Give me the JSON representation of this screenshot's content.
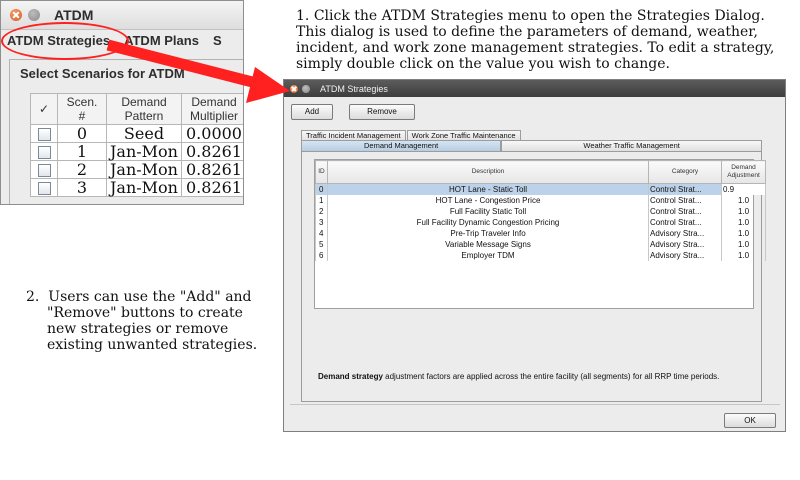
{
  "annotations": {
    "step1_number": "1.",
    "step1_text": "Click the ATDM Strategies menu to open the Strategies Dialog. This dialog is used to define the parameters of demand, weather, incident, and work zone management strategies.  To edit a strategy, simply double click on the value you wish to change.",
    "step2_number": "2.",
    "step2_text": "Users can use the \"Add\" and \"Remove\" buttons to create new strategies or remove existing unwanted strategies."
  },
  "main_window": {
    "title": "ATDM",
    "menu": [
      "ATDM Strategies",
      "ATDM Plans",
      "S"
    ],
    "panel_title": "Select Scenarios for ATDM",
    "table": {
      "headers": [
        "✓",
        "Scen.\n#",
        "Demand\nPattern",
        "Demand\nMultiplier"
      ],
      "rows": [
        {
          "scen": "0",
          "pattern": "Seed",
          "multiplier": "0.0000"
        },
        {
          "scen": "1",
          "pattern": "Jan-Mon",
          "multiplier": "0.8261"
        },
        {
          "scen": "2",
          "pattern": "Jan-Mon",
          "multiplier": "0.8261"
        },
        {
          "scen": "3",
          "pattern": "Jan-Mon",
          "multiplier": "0.8261"
        }
      ]
    }
  },
  "dialog": {
    "title": "ATDM Strategies",
    "add_label": "Add",
    "remove_label": "Remove",
    "tabs_row1": [
      "Traffic Incident Management",
      "Work Zone Traffic Maintenance"
    ],
    "tabs_row2": [
      "Demand Management",
      "Weather Traffic Management"
    ],
    "active_tab": "Demand Management",
    "table": {
      "headers": {
        "id": "ID",
        "description": "Description",
        "category": "Category",
        "adjustment": "Demand\nAdjustment"
      },
      "rows": [
        {
          "id": "0",
          "description": "HOT Lane - Static Toll",
          "category": "Control Strat...",
          "adjustment": "0.9",
          "selected": true
        },
        {
          "id": "1",
          "description": "HOT Lane - Congestion Price",
          "category": "Control Strat...",
          "adjustment": "1.0"
        },
        {
          "id": "2",
          "description": "Full Facility Static Toll",
          "category": "Control Strat...",
          "adjustment": "1.0"
        },
        {
          "id": "3",
          "description": "Full Facility Dynamic Congestion Pricing",
          "category": "Control Strat...",
          "adjustment": "1.0"
        },
        {
          "id": "4",
          "description": "Pre-Trip Traveler Info",
          "category": "Advisory Stra...",
          "adjustment": "1.0"
        },
        {
          "id": "5",
          "description": "Variable Message Signs",
          "category": "Advisory Stra...",
          "adjustment": "1.0"
        },
        {
          "id": "6",
          "description": "Employer TDM",
          "category": "Advisory Stra...",
          "adjustment": "1.0"
        }
      ]
    },
    "description_bold": "Demand strategy",
    "description_rest": " adjustment factors are applied across the entire facility (all segments) for all RRP time periods.",
    "ok_label": "OK"
  },
  "colors": {
    "highlight_red": "#ff2020",
    "selection_blue": "#bcd2ea",
    "dialog_title_bar": "#4a4a4a"
  }
}
